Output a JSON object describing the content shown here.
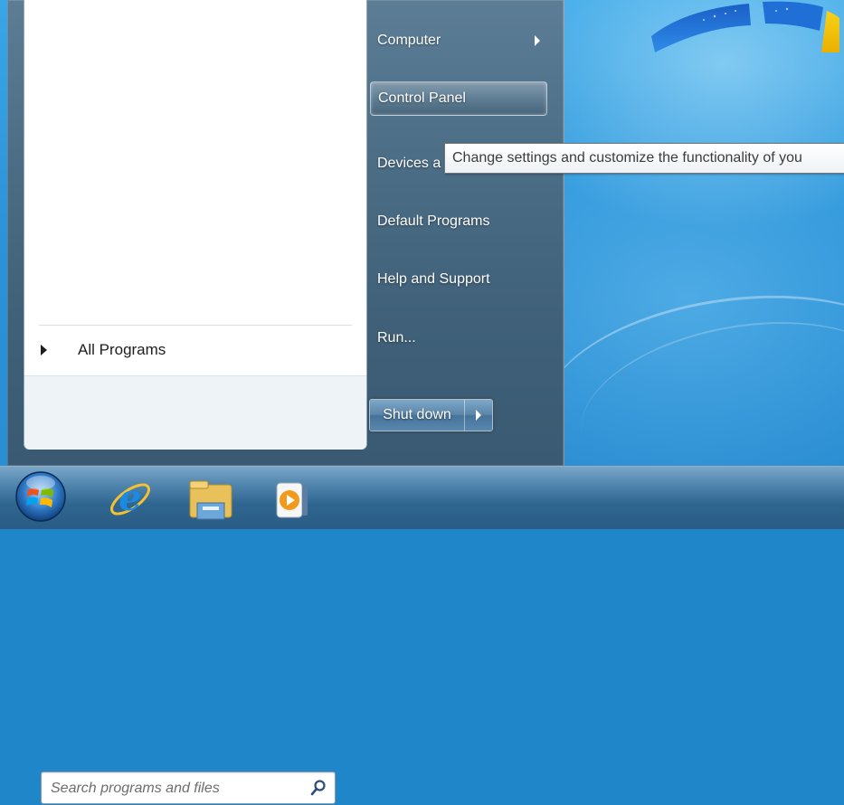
{
  "start_menu": {
    "left_pane": {
      "all_programs_label": "All Programs",
      "search": {
        "placeholder": "Search programs and files"
      }
    },
    "right_pane": {
      "items": [
        {
          "label": "Computer",
          "has_submenu": true
        },
        {
          "label": "Control Panel",
          "highlighted": true
        },
        {
          "label": "Devices a"
        },
        {
          "label": "Default Programs"
        },
        {
          "label": "Help and Support"
        },
        {
          "label": "Run..."
        }
      ],
      "shutdown_label": "Shut down"
    },
    "tooltip": "Change settings and customize the functionality of you"
  },
  "taskbar": {
    "icons": [
      "windows-start-orb-icon",
      "internet-explorer-icon",
      "windows-explorer-icon",
      "media-player-icon"
    ]
  },
  "colors": {
    "menu_frame": "#4b6d86",
    "desktop": "#2b93d8",
    "taskbar": "#2f6690"
  }
}
